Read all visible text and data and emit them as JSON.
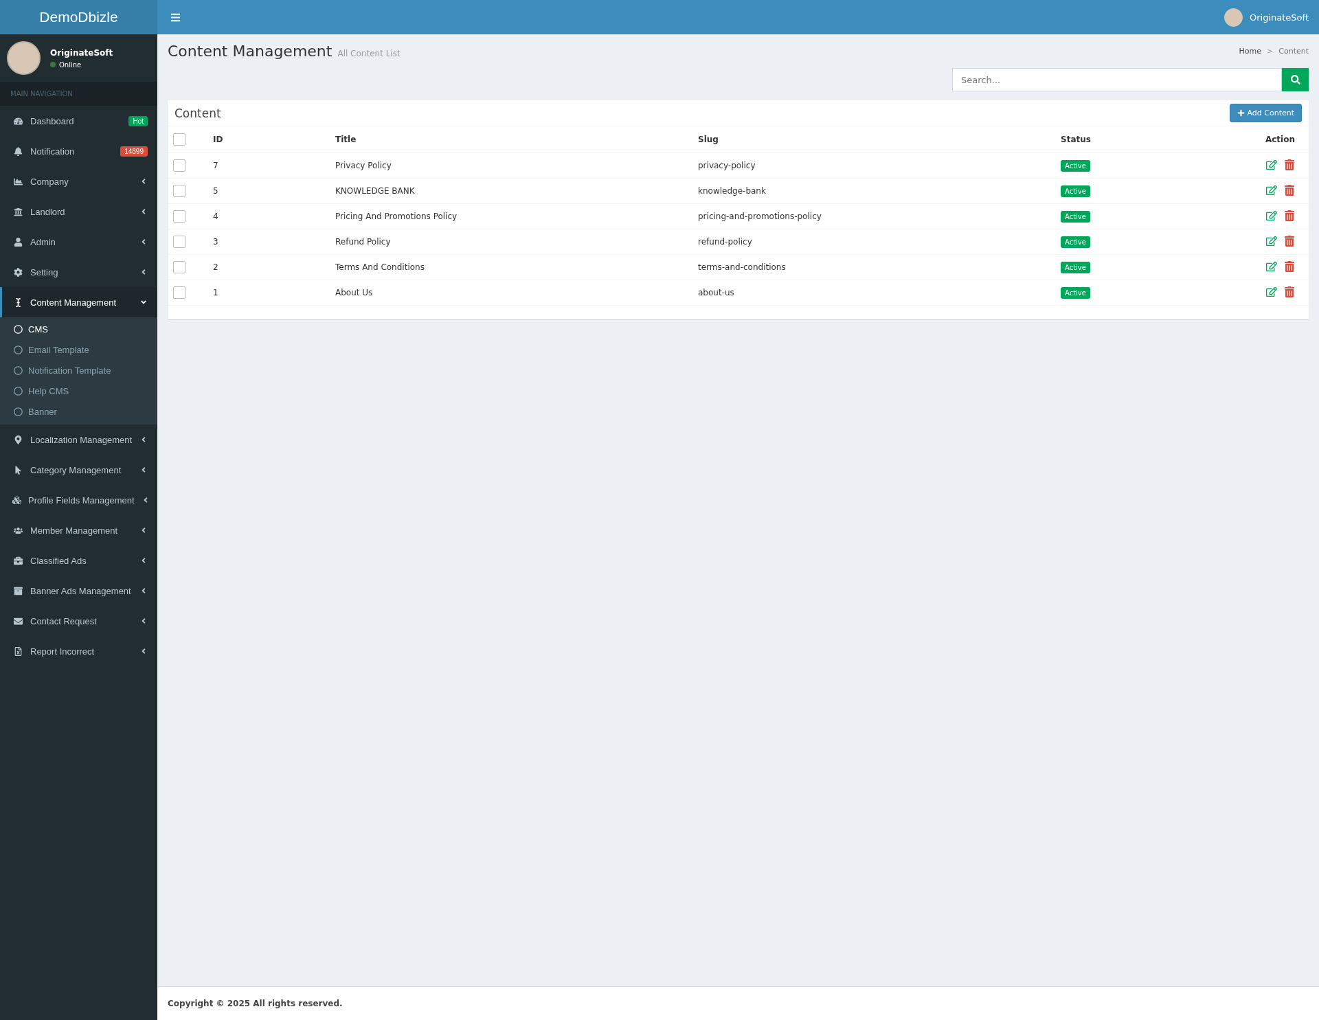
{
  "brand": "DemoDbizle",
  "header": {
    "user_name": "OriginateSoft"
  },
  "sidebar": {
    "user": {
      "name": "OriginateSoft",
      "status": "Online"
    },
    "section_label": "MAIN NAVIGATION",
    "items": [
      {
        "label": "Dashboard",
        "kind": "badge",
        "badge": {
          "text": "Hot",
          "color": "#00a65a"
        },
        "selected": false
      },
      {
        "label": "Notification",
        "kind": "badge",
        "badge": {
          "text": "14899",
          "color": "#dd4b39"
        },
        "selected": false
      },
      {
        "label": "Company",
        "kind": "menu",
        "expanded": false,
        "selected": false
      },
      {
        "label": "Landlord",
        "kind": "menu",
        "expanded": false,
        "selected": false
      },
      {
        "label": "Admin",
        "kind": "menu",
        "expanded": false,
        "selected": false
      },
      {
        "label": "Setting",
        "kind": "menu",
        "expanded": false,
        "selected": false
      },
      {
        "label": "Content Management",
        "kind": "menu",
        "expanded": true,
        "selected": true,
        "children": [
          {
            "label": "CMS",
            "selected": true
          },
          {
            "label": "Email Template",
            "selected": false
          },
          {
            "label": "Notification Template",
            "selected": false
          },
          {
            "label": "Help CMS",
            "selected": false
          },
          {
            "label": "Banner",
            "selected": false
          }
        ]
      },
      {
        "label": "Localization Management",
        "kind": "menu",
        "expanded": false,
        "selected": false
      },
      {
        "label": "Category Management",
        "kind": "menu",
        "expanded": false,
        "selected": false
      },
      {
        "label": "Profile Fields Management",
        "kind": "menu",
        "expanded": false,
        "selected": false
      },
      {
        "label": "Member Management",
        "kind": "menu",
        "expanded": false,
        "selected": false
      },
      {
        "label": "Classified Ads",
        "kind": "menu",
        "expanded": false,
        "selected": false
      },
      {
        "label": "Banner Ads Management",
        "kind": "menu",
        "expanded": false,
        "selected": false
      },
      {
        "label": "Contact Request",
        "kind": "menu",
        "expanded": false,
        "selected": false
      },
      {
        "label": "Report Incorrect",
        "kind": "menu",
        "expanded": false,
        "selected": false
      }
    ]
  },
  "page": {
    "title": "Content Management",
    "subtitle": "All Content List",
    "breadcrumb": [
      "Home",
      "Content"
    ],
    "breadcrumb_separator": ">"
  },
  "search": {
    "placeholder": "Search..."
  },
  "panel": {
    "title": "Content",
    "add_button": "Add Content",
    "columns": [
      "ID",
      "Title",
      "Slug",
      "Status",
      "Action"
    ],
    "select_all_checked": false,
    "rows": [
      {
        "checked": false,
        "id": "7",
        "title": "Privacy Policy",
        "slug": "privacy-policy",
        "status": "Active"
      },
      {
        "checked": false,
        "id": "5",
        "title": "KNOWLEDGE BANK",
        "slug": "knowledge-bank",
        "status": "Active"
      },
      {
        "checked": false,
        "id": "4",
        "title": "Pricing And Promotions Policy",
        "slug": "pricing-and-promotions-policy",
        "status": "Active"
      },
      {
        "checked": false,
        "id": "3",
        "title": "Refund Policy",
        "slug": "refund-policy",
        "status": "Active"
      },
      {
        "checked": false,
        "id": "2",
        "title": "Terms And Conditions",
        "slug": "terms-and-conditions",
        "status": "Active"
      },
      {
        "checked": false,
        "id": "1",
        "title": "About Us",
        "slug": "about-us",
        "status": "Active"
      }
    ]
  },
  "footer": {
    "text": "Copyright © 2025 All rights reserved."
  }
}
